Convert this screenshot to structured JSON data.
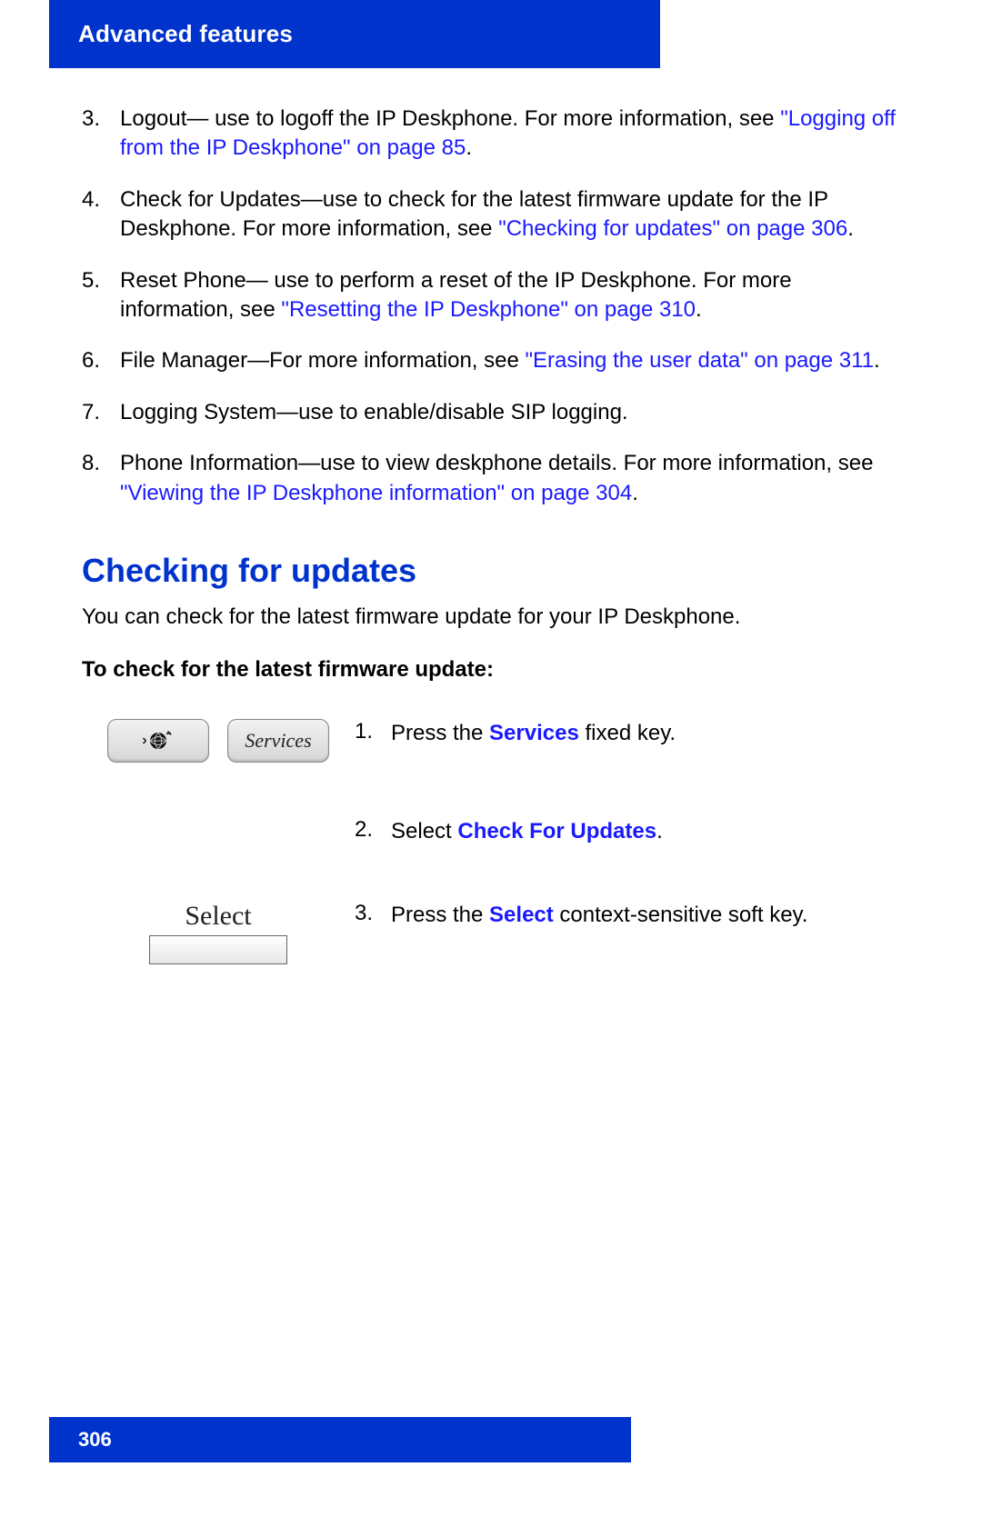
{
  "header": {
    "title": "Advanced features"
  },
  "list": {
    "items": [
      {
        "num": "3.",
        "text_a": "Logout— use to logoff the IP Deskphone. For more information, see ",
        "link": "\"Logging off from the IP Deskphone\" on page 85",
        "text_b": "."
      },
      {
        "num": "4.",
        "text_a": "Check for Updates—use to check for the latest firmware update for the IP Deskphone. For more information, see ",
        "link": "\"Checking for updates\" on page 306",
        "text_b": "."
      },
      {
        "num": "5.",
        "text_a": "Reset Phone— use to perform a reset of the IP Deskphone. For more information, see ",
        "link": "\"Resetting the IP Deskphone\" on page 310",
        "text_b": "."
      },
      {
        "num": "6.",
        "text_a": "File Manager—For more information, see ",
        "link": "\"Erasing the user data\" on page 311",
        "text_b": "."
      },
      {
        "num": "7.",
        "text_a": "Logging System—use to enable/disable SIP logging.",
        "link": "",
        "text_b": ""
      },
      {
        "num": "8.",
        "text_a": "Phone Information—use to view deskphone details. For more information, see ",
        "link": "\"Viewing the IP Deskphone information\" on page 304",
        "text_b": "."
      }
    ]
  },
  "section": {
    "heading": "Checking for updates",
    "intro": "You can check for the latest firmware update for your IP Deskphone.",
    "subhead": "To check for the latest firmware update:"
  },
  "buttons": {
    "services_label": "Services",
    "select_label": "Select"
  },
  "steps": {
    "s1": {
      "num": "1.",
      "pre": "Press the ",
      "bold": "Services",
      "post": " fixed key."
    },
    "s2": {
      "num": "2.",
      "pre": "Select ",
      "bold": "Check For Updates",
      "post": "."
    },
    "s3": {
      "num": "3.",
      "pre": "Press the ",
      "bold": "Select",
      "post": " context-sensitive soft key."
    }
  },
  "footer": {
    "page_number": "306"
  }
}
